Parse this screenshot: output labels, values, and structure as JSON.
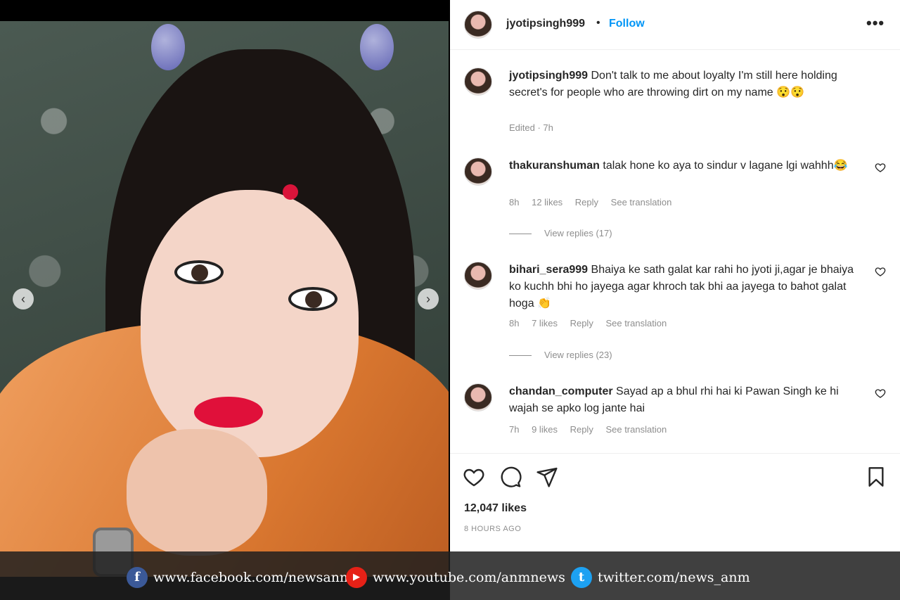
{
  "colors": {
    "follow": "#0095f6",
    "text": "#262626",
    "muted": "#8e8e8e"
  },
  "photo": {
    "prev_icon": "chevron-left-icon",
    "next_icon": "chevron-right-icon",
    "prev_glyph": "‹",
    "next_glyph": "›"
  },
  "header": {
    "username": "jyotipsingh999",
    "separator": "•",
    "follow_label": "Follow",
    "more_label": "•••"
  },
  "caption": {
    "username": "jyotipsingh999",
    "text": "Don't talk to me about loyalty I'm still here holding secret's for people who are throwing dirt on my name 😯😯",
    "edited": "Edited · 7h"
  },
  "comments": [
    {
      "username": "thakuranshuman",
      "text": "talak hone ko aya to sindur v lagane lgi wahhh😂",
      "time": "8h",
      "likes": "12 likes",
      "reply": "Reply",
      "translate": "See translation",
      "view_replies": "View replies (17)"
    },
    {
      "username": "bihari_sera999",
      "text": "Bhaiya ke sath galat kar rahi ho jyoti ji,agar je bhaiya ko kuchh bhi ho jayega agar khroch tak bhi aa jayega to bahot galat hoga 👏",
      "time": "8h",
      "likes": "7 likes",
      "reply": "Reply",
      "translate": "See translation",
      "view_replies": "View replies (23)"
    },
    {
      "username": "chandan_computer",
      "text": "Sayad ap a bhul rhi hai ki Pawan Singh ke hi wajah se apko log jante hai",
      "time": "7h",
      "likes": "9 likes",
      "reply": "Reply",
      "translate": "See translation"
    }
  ],
  "post": {
    "likes": "12,047 likes",
    "time_ago": "8 HOURS AGO"
  },
  "social_bar": [
    {
      "icon": "facebook-icon",
      "glyph": "f",
      "color": "#3b5998",
      "text": "www.facebook.com/newsanm"
    },
    {
      "icon": "youtube-icon",
      "glyph": "▶",
      "color": "#e62117",
      "text": "www.youtube.com/anmnews"
    },
    {
      "icon": "twitter-icon",
      "glyph": "t",
      "color": "#1da1f2",
      "text": "twitter.com/news_anm"
    }
  ]
}
